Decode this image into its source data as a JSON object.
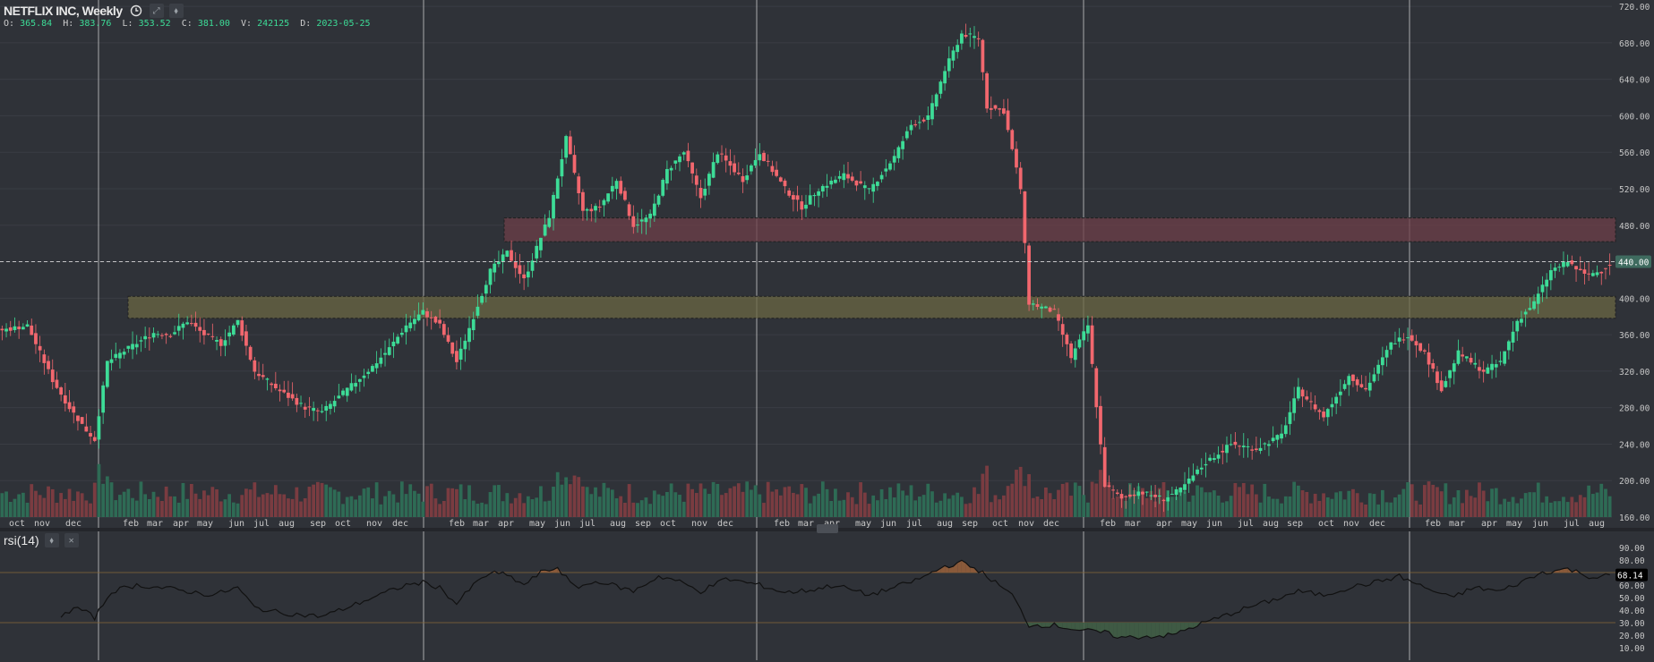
{
  "header": {
    "title": "NETFLIX INC, Weekly",
    "clock_icon": "clock-icon",
    "expand_icon": "expand-icon",
    "settings_icon": "drop-icon"
  },
  "ohlc": {
    "o_label": "O:",
    "o": "365.84",
    "h_label": "H:",
    "h": "383.76",
    "l_label": "L:",
    "l": "353.52",
    "c_label": "C:",
    "c": "381.00",
    "v_label": "V:",
    "v": "242125",
    "d_label": "D:",
    "d": "2023-05-25"
  },
  "rsi_panel": {
    "name": "rsi(14)",
    "current_value": "68.14",
    "close_icon": "close-icon",
    "settings_icon": "drop-icon"
  },
  "colors": {
    "background": "#2f3238",
    "up": "#3ddc97",
    "down": "#f2676e",
    "volume_up": "#2e6b55",
    "volume_down": "#7a3c41",
    "grid": "#3a3d44",
    "resistance_zone": "#6e3f48",
    "support_zone": "#6b6743",
    "rsi_line": "#111111",
    "rsi_overbought_fill": "#8a5a3a",
    "rsi_oversold_fill": "#3f5a44",
    "price_badge": "#3f6b5f"
  },
  "chart_data": {
    "type": "candlestick",
    "title": "NETFLIX INC, Weekly",
    "x_ticks": [
      "oct",
      "nov",
      "dec",
      "feb",
      "mar",
      "apr",
      "may",
      "jun",
      "jul",
      "aug",
      "sep",
      "oct",
      "nov",
      "dec",
      "feb",
      "mar",
      "apr",
      "may",
      "jun",
      "jul",
      "aug",
      "sep",
      "oct",
      "nov",
      "dec",
      "feb",
      "mar",
      "apr",
      "may",
      "jun",
      "jul",
      "aug",
      "sep",
      "oct",
      "nov",
      "dec",
      "feb",
      "mar",
      "apr",
      "may",
      "jun",
      "jul",
      "aug",
      "sep",
      "oct",
      "nov",
      "dec",
      "feb",
      "mar",
      "apr",
      "may",
      "jun",
      "jul",
      "aug"
    ],
    "y_ticks": [
      "720.00",
      "680.00",
      "640.00",
      "600.00",
      "560.00",
      "520.00",
      "480.00",
      "440.00",
      "400.00",
      "360.00",
      "320.00",
      "280.00",
      "240.00",
      "200.00",
      "160.00"
    ],
    "ylim": [
      160,
      725
    ],
    "current_price_label": "440.00",
    "current_price": 440,
    "resistance_zone": [
      462,
      488
    ],
    "support_zone": [
      378,
      402
    ],
    "price_path": [
      [
        0,
        365
      ],
      [
        6,
        370
      ],
      [
        12,
        310
      ],
      [
        16,
        280
      ],
      [
        20,
        255
      ],
      [
        22,
        245
      ],
      [
        25,
        330
      ],
      [
        30,
        345
      ],
      [
        36,
        362
      ],
      [
        40,
        360
      ],
      [
        44,
        375
      ],
      [
        48,
        360
      ],
      [
        52,
        350
      ],
      [
        56,
        375
      ],
      [
        60,
        320
      ],
      [
        66,
        298
      ],
      [
        72,
        280
      ],
      [
        76,
        275
      ],
      [
        82,
        300
      ],
      [
        88,
        325
      ],
      [
        92,
        345
      ],
      [
        96,
        370
      ],
      [
        100,
        385
      ],
      [
        104,
        370
      ],
      [
        108,
        330
      ],
      [
        112,
        380
      ],
      [
        116,
        430
      ],
      [
        120,
        450
      ],
      [
        124,
        420
      ],
      [
        130,
        490
      ],
      [
        134,
        575
      ],
      [
        138,
        495
      ],
      [
        142,
        500
      ],
      [
        146,
        530
      ],
      [
        150,
        480
      ],
      [
        154,
        490
      ],
      [
        158,
        540
      ],
      [
        162,
        560
      ],
      [
        166,
        510
      ],
      [
        170,
        560
      ],
      [
        176,
        530
      ],
      [
        180,
        560
      ],
      [
        186,
        520
      ],
      [
        190,
        500
      ],
      [
        194,
        520
      ],
      [
        200,
        535
      ],
      [
        206,
        518
      ],
      [
        212,
        555
      ],
      [
        216,
        590
      ],
      [
        220,
        598
      ],
      [
        224,
        650
      ],
      [
        228,
        690
      ],
      [
        232,
        685
      ],
      [
        234,
        610
      ],
      [
        238,
        605
      ],
      [
        242,
        520
      ],
      [
        244,
        395
      ],
      [
        250,
        385
      ],
      [
        254,
        335
      ],
      [
        258,
        370
      ],
      [
        262,
        195
      ],
      [
        266,
        180
      ],
      [
        270,
        188
      ],
      [
        276,
        180
      ],
      [
        280,
        190
      ],
      [
        286,
        220
      ],
      [
        292,
        240
      ],
      [
        298,
        235
      ],
      [
        304,
        250
      ],
      [
        308,
        300
      ],
      [
        314,
        270
      ],
      [
        320,
        315
      ],
      [
        324,
        300
      ],
      [
        330,
        350
      ],
      [
        334,
        360
      ],
      [
        338,
        340
      ],
      [
        342,
        300
      ],
      [
        346,
        340
      ],
      [
        352,
        320
      ],
      [
        356,
        330
      ],
      [
        360,
        375
      ],
      [
        364,
        395
      ],
      [
        368,
        430
      ],
      [
        372,
        440
      ],
      [
        376,
        425
      ],
      [
        380,
        430
      ],
      [
        382,
        438
      ]
    ],
    "rsi": {
      "ylim": [
        0,
        100
      ],
      "y_ticks": [
        "90.00",
        "80.00",
        "70.00",
        "60.00",
        "50.00",
        "40.00",
        "30.00",
        "20.00",
        "10.00"
      ],
      "overbought": 70,
      "oversold": 30,
      "current": 68.14,
      "path": [
        [
          14,
          36
        ],
        [
          18,
          42
        ],
        [
          22,
          34
        ],
        [
          26,
          55
        ],
        [
          32,
          60
        ],
        [
          40,
          57
        ],
        [
          50,
          52
        ],
        [
          56,
          58
        ],
        [
          60,
          42
        ],
        [
          66,
          38
        ],
        [
          72,
          36
        ],
        [
          76,
          35
        ],
        [
          82,
          42
        ],
        [
          88,
          50
        ],
        [
          92,
          55
        ],
        [
          96,
          60
        ],
        [
          100,
          62
        ],
        [
          104,
          58
        ],
        [
          108,
          45
        ],
        [
          112,
          60
        ],
        [
          116,
          70
        ],
        [
          120,
          68
        ],
        [
          124,
          60
        ],
        [
          128,
          70
        ],
        [
          132,
          74
        ],
        [
          136,
          58
        ],
        [
          142,
          63
        ],
        [
          150,
          55
        ],
        [
          156,
          67
        ],
        [
          160,
          64
        ],
        [
          166,
          55
        ],
        [
          172,
          65
        ],
        [
          180,
          60
        ],
        [
          186,
          54
        ],
        [
          192,
          56
        ],
        [
          198,
          60
        ],
        [
          206,
          52
        ],
        [
          212,
          58
        ],
        [
          218,
          65
        ],
        [
          224,
          75
        ],
        [
          228,
          78
        ],
        [
          232,
          72
        ],
        [
          236,
          62
        ],
        [
          240,
          52
        ],
        [
          244,
          28
        ],
        [
          250,
          28
        ],
        [
          256,
          24
        ],
        [
          262,
          22
        ],
        [
          266,
          18
        ],
        [
          272,
          19
        ],
        [
          278,
          20
        ],
        [
          284,
          28
        ],
        [
          290,
          35
        ],
        [
          296,
          42
        ],
        [
          302,
          48
        ],
        [
          308,
          55
        ],
        [
          314,
          52
        ],
        [
          320,
          58
        ],
        [
          326,
          62
        ],
        [
          332,
          67
        ],
        [
          338,
          58
        ],
        [
          344,
          50
        ],
        [
          350,
          58
        ],
        [
          356,
          55
        ],
        [
          362,
          64
        ],
        [
          366,
          70
        ],
        [
          372,
          73
        ],
        [
          378,
          66
        ],
        [
          382,
          68
        ]
      ]
    }
  }
}
